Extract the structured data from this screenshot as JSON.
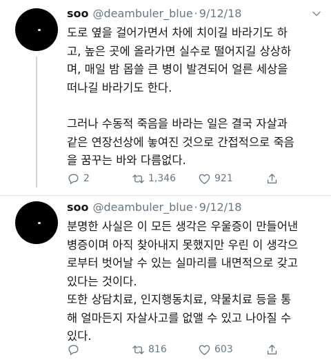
{
  "tweets": [
    {
      "name": "soo",
      "handle": "@deambuler_blue",
      "separator": "·",
      "date": "9/12/18",
      "lines": [
        "도로 옆을 걸어가면서 차에 치이길 바라기도 하",
        "고, 높은 곳에 올라가면 실수로 떨어지길 상상하",
        "며, 매일 밤 몹쓸 큰 병이 발견되어 얼른 세상을",
        "떠나길 바라기도 한다.",
        "",
        "그러나 수동적 죽음을 바라는 일은 결국 자살과",
        "같은 연장선상에 놓여진 것으로 간접적으로 죽음",
        "을 꿈꾸는 바와 다름없다."
      ],
      "replies": "2",
      "retweets": "1,346",
      "likes": "921"
    },
    {
      "name": "soo",
      "handle": "@deambuler_blue",
      "separator": "·",
      "date": "9/12/18",
      "lines": [
        "분명한 사실은 이 모든 생각은 우울증이 만들어낸",
        "병증이며 아직 찾아내지 못했지만 우린 이 생각으",
        "로부터 벗어날 수 있는 실마리를 내면적으로 갖고",
        "있다는 것이다.",
        "또한 상담치료, 인지행동치료, 약물치료 등을 통",
        "해 얼마든지 자살사고를 없앨 수 있고 나아질 수",
        "있다."
      ],
      "replies": "",
      "retweets": "816",
      "likes": "603"
    }
  ]
}
